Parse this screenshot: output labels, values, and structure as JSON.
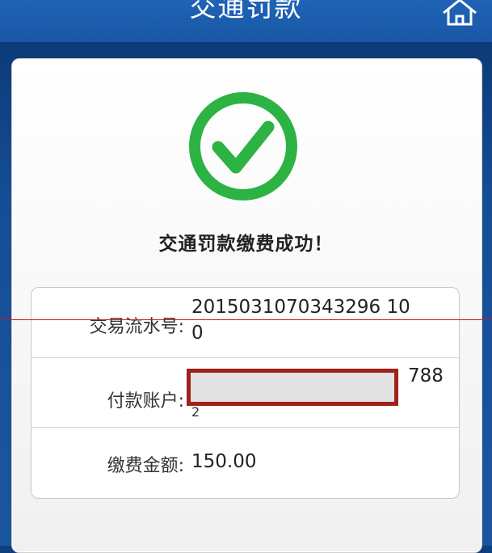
{
  "header": {
    "title": "交通罚款",
    "home_icon": "home-icon"
  },
  "result": {
    "icon": "check-circle-icon",
    "message": "交通罚款缴费成功！",
    "color": "#2db244"
  },
  "details": {
    "transaction_label": "交易流水号:",
    "transaction_value_line1": "2015031070343296 10",
    "transaction_value_line2": "0",
    "account_label": "付款账户:",
    "account_tail": "788",
    "account_line2": "2",
    "amount_label": "缴费金额:",
    "amount_value": "150.00"
  },
  "colors": {
    "header": "#1957a5",
    "mask_border": "#a02118",
    "overlay_line": "#c8151b"
  }
}
